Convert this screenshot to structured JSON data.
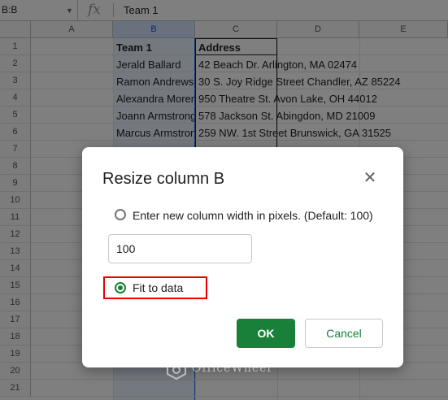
{
  "formula_bar": {
    "name_box": "B:B",
    "fx_symbol": "fx",
    "value": "Team 1"
  },
  "columns": [
    "A",
    "B",
    "C",
    "D",
    "E"
  ],
  "rows": [
    "1",
    "2",
    "3",
    "4",
    "5",
    "6",
    "7",
    "8",
    "9",
    "10",
    "11",
    "12",
    "13",
    "14",
    "15",
    "16",
    "17",
    "18",
    "19",
    "20",
    "21"
  ],
  "cells": {
    "header_b": "Team 1",
    "header_c": "Address",
    "b": [
      "Jerald Ballard",
      "Ramon Andrews",
      "Alexandra Morer",
      "Joann Armstrong",
      "Marcus Armstron"
    ],
    "c": [
      "42 Beach Dr. Arlington, MA 02474",
      "30 S. Joy Ridge Street Chandler, AZ 85224",
      "950 Theatre St. Avon Lake, OH 44012",
      "578 Jackson St. Abingdon, MD 21009",
      "259 NW. 1st Street Brunswick, GA 31525"
    ]
  },
  "dialog": {
    "title": "Resize column B",
    "option_pixels": "Enter new column width in pixels. (Default: 100)",
    "width_value": "100",
    "option_fit": "Fit to data",
    "ok_label": "OK",
    "cancel_label": "Cancel",
    "selected_option": "fit"
  },
  "watermark": "OfficeWheel",
  "colors": {
    "accent": "#188038",
    "highlight": "#e60000",
    "selection": "#1a73e8"
  },
  "icons": {
    "close": "close-icon",
    "dropdown": "chevron-down-icon"
  }
}
